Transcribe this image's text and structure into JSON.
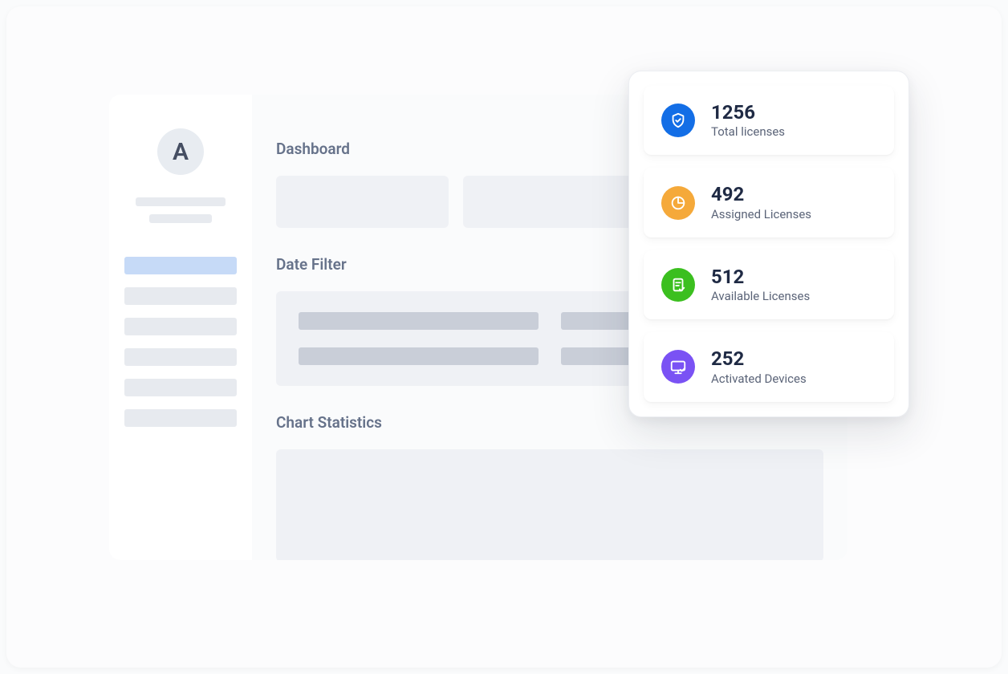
{
  "sidebar": {
    "avatar_initial": "A"
  },
  "sections": {
    "dashboard_title": "Dashboard",
    "date_filter_title": "Date Filter",
    "chart_title": "Chart Statistics"
  },
  "stats": [
    {
      "value": "1256",
      "label": "Total licenses",
      "icon": "shield-check",
      "color": "#136ee6"
    },
    {
      "value": "492",
      "label": "Assigned Licenses",
      "icon": "pie-slice",
      "color": "#f5a93a"
    },
    {
      "value": "512",
      "label": "Available Licenses",
      "icon": "document-check",
      "color": "#3bbf1f"
    },
    {
      "value": "252",
      "label": "Activated Devices",
      "icon": "monitor-check",
      "color": "#7a52f4"
    }
  ]
}
